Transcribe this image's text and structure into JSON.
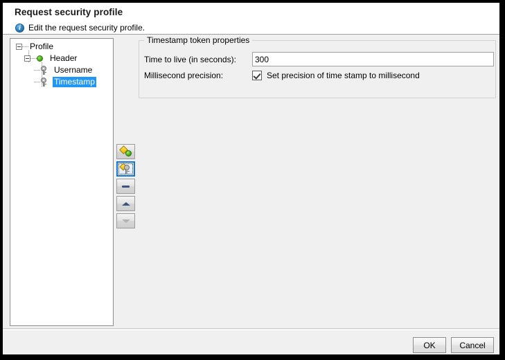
{
  "dialog": {
    "title": "Request security profile",
    "subtitle": "Edit the request security profile.",
    "info_icon": "info-icon"
  },
  "tree": {
    "nodes": [
      {
        "label": "Profile",
        "icon": "expander-minus-icon",
        "level": 0,
        "selected": false
      },
      {
        "label": "Header",
        "icon": "green-circle-icon",
        "level": 1,
        "selected": false
      },
      {
        "label": "Username",
        "icon": "key-icon",
        "level": 2,
        "selected": false
      },
      {
        "label": "Timestamp",
        "icon": "key-icon",
        "level": 2,
        "selected": true
      }
    ],
    "selection_color": "#2196f3"
  },
  "toolbar": {
    "buttons": [
      {
        "name": "add-token-button",
        "icon": "add-certificate-icon",
        "state": "enabled"
      },
      {
        "name": "add-key-button",
        "icon": "add-key-icon",
        "state": "focused"
      },
      {
        "name": "remove-button",
        "icon": "minus-icon",
        "state": "enabled"
      },
      {
        "name": "move-up-button",
        "icon": "chevron-up-icon",
        "state": "enabled"
      },
      {
        "name": "move-down-button",
        "icon": "chevron-down-icon",
        "state": "disabled"
      }
    ]
  },
  "properties": {
    "group_title": "Timestamp token properties",
    "time_to_live": {
      "label": "Time to live (in seconds):",
      "value": "300",
      "placeholder": ""
    },
    "millisecond_precision": {
      "label": "Millisecond precision:",
      "checkbox_label": "Set precision of time stamp to millisecond",
      "checked": true
    }
  },
  "footer": {
    "ok_label": "OK",
    "cancel_label": "Cancel"
  }
}
